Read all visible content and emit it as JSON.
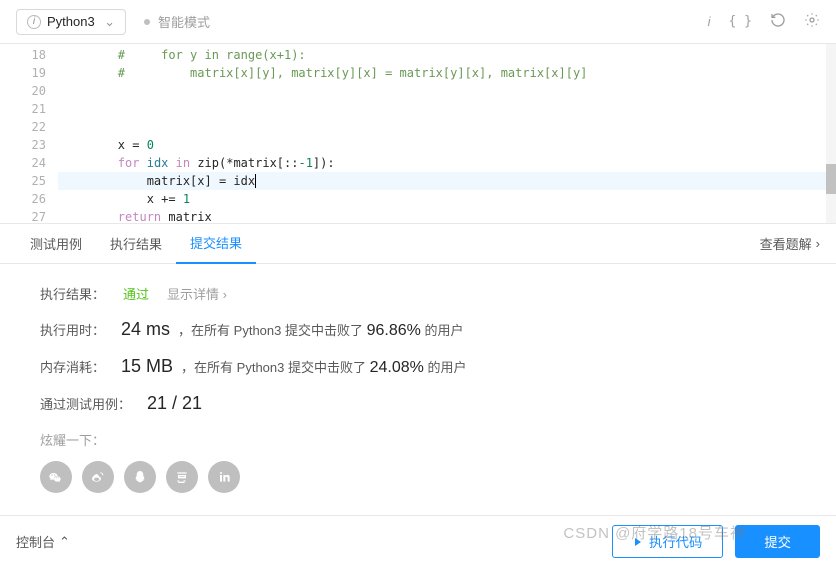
{
  "toolbar": {
    "language": "Python3",
    "mode": "智能模式"
  },
  "code": {
    "lines": [
      {
        "n": 18,
        "indent": "        ",
        "type": "comment",
        "text": "#     for y in range(x+1):"
      },
      {
        "n": 19,
        "indent": "        ",
        "type": "comment",
        "text": "#         matrix[x][y], matrix[y][x] = matrix[y][x], matrix[x][y]"
      },
      {
        "n": 20,
        "indent": "",
        "type": "blank",
        "text": ""
      },
      {
        "n": 21,
        "indent": "",
        "type": "blank",
        "text": ""
      },
      {
        "n": 22,
        "indent": "",
        "type": "blank",
        "text": ""
      },
      {
        "n": 23,
        "indent": "        ",
        "type": "code",
        "html": "x = <span class=\"c-num\">0</span>"
      },
      {
        "n": 24,
        "indent": "        ",
        "type": "code",
        "html": "<span class=\"c-kw\">for</span> <span class=\"c-id\">idx</span> <span class=\"c-kw\">in</span> zip(*matrix[::<span class=\"c-num\">-1</span>]):"
      },
      {
        "n": 25,
        "indent": "            ",
        "type": "code",
        "hl": true,
        "html": "matrix[x] = idx<span style=\"border-right:1px solid #000;\"></span>"
      },
      {
        "n": 26,
        "indent": "            ",
        "type": "code",
        "html": "x += <span class=\"c-num\">1</span>"
      },
      {
        "n": 27,
        "indent": "        ",
        "type": "code",
        "html": "<span class=\"c-kw\">return</span> matrix"
      }
    ]
  },
  "tabs": {
    "items": [
      "测试用例",
      "执行结果",
      "提交结果"
    ],
    "active": 2,
    "view_solution": "查看题解"
  },
  "results": {
    "status_label": "执行结果：",
    "status_value": "通过",
    "show_details": "显示详情",
    "runtime_label": "执行用时：",
    "runtime_value": "24 ms",
    "runtime_desc_pre": "，在所有 Python3 提交中击败了",
    "runtime_pct": "96.86%",
    "runtime_desc_post": " 的用户",
    "memory_label": "内存消耗：",
    "memory_value": "15 MB",
    "memory_desc_pre": "，在所有 Python3 提交中击败了",
    "memory_pct": "24.08%",
    "memory_desc_post": " 的用户",
    "testcase_label": "通过测试用例：",
    "testcase_value": "21 / 21",
    "share_label": "炫耀一下："
  },
  "footer": {
    "console": "控制台",
    "run": "执行代码",
    "submit": "提交"
  },
  "watermark": "CSDN @府学路18号车神"
}
